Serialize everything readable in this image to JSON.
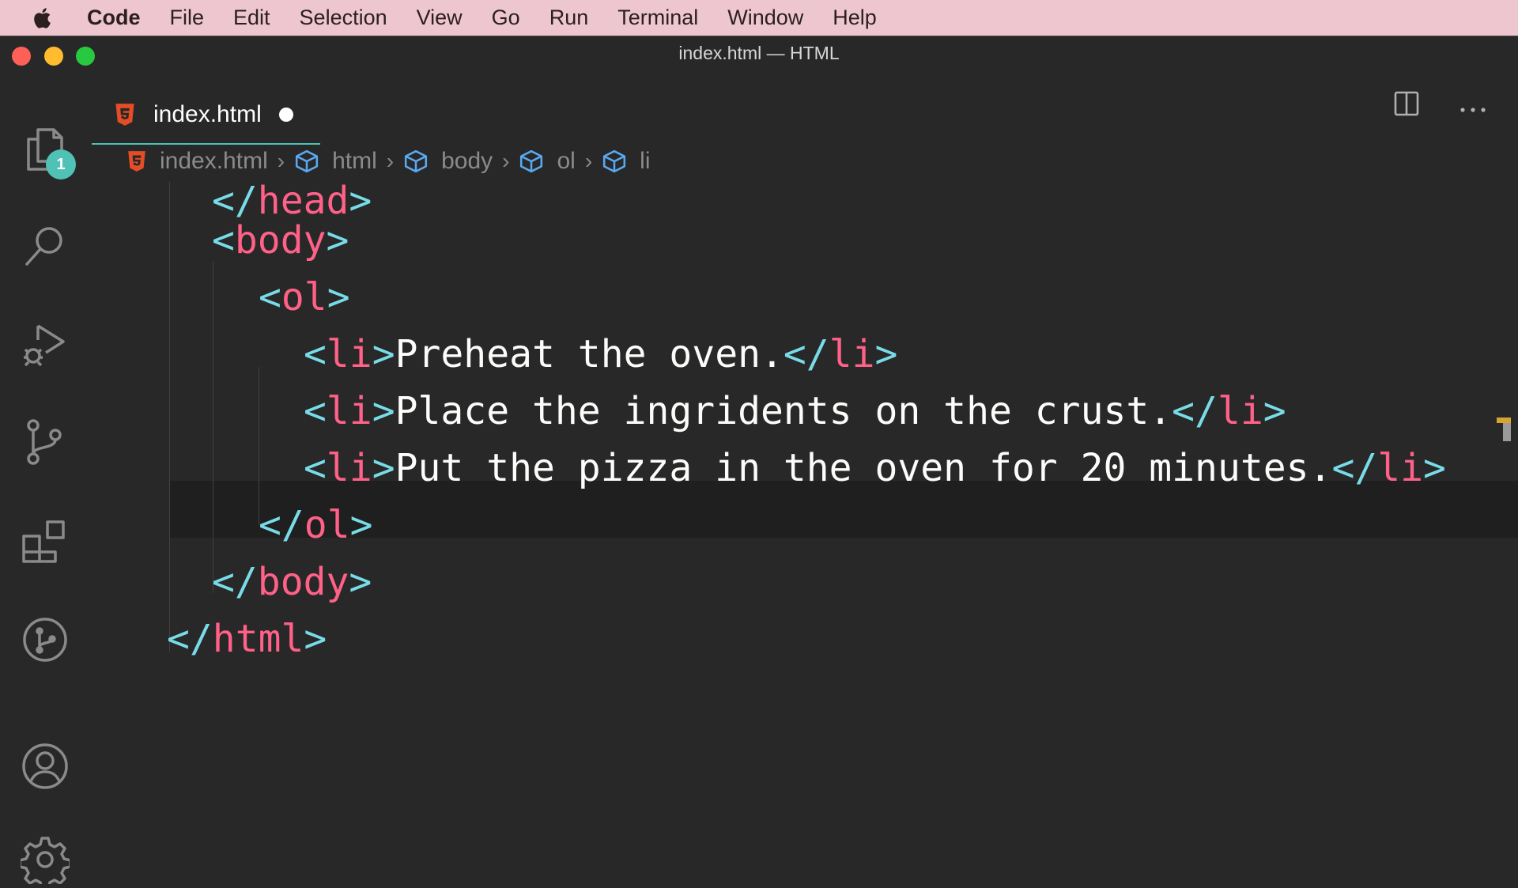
{
  "menubar": {
    "app": "Code",
    "items": [
      "File",
      "Edit",
      "Selection",
      "View",
      "Go",
      "Run",
      "Terminal",
      "Window",
      "Help"
    ]
  },
  "window": {
    "title": "index.html — HTML"
  },
  "activity_bar": {
    "icons": [
      "files-icon",
      "search-icon",
      "run-debug-icon",
      "source-control-icon",
      "extensions-icon",
      "git-graph-icon",
      "account-icon",
      "settings-gear-icon"
    ],
    "explorer_badge": "1"
  },
  "tab": {
    "label": "index.html",
    "dirty": true
  },
  "breadcrumbs": [
    "index.html",
    "html",
    "body",
    "ol",
    "li"
  ],
  "code_lines": [
    {
      "open": "</",
      "tag": "head",
      "close": ">"
    },
    {
      "open": "<",
      "tag": "body",
      "close": ">"
    },
    {
      "open": "<",
      "tag": "ol",
      "close": ">"
    },
    {
      "text": "Preheat the oven."
    },
    {
      "text": "Place the ingridents on the crust."
    },
    {
      "text": "Put the pizza in the oven for 20 minutes."
    },
    {
      "open": "</",
      "tag": "ol",
      "close": ">"
    },
    {
      "open": "</",
      "tag": "body",
      "close": ">"
    },
    {
      "open": "</",
      "tag": "html",
      "close": ">"
    }
  ],
  "li_tag": "li",
  "colors": {
    "menubar_bg": "#eec6cf",
    "editor_bg": "#282828",
    "punctuation": "#78dce8",
    "tag_name": "#ff6188",
    "text": "#fcfcfa",
    "accent": "#4fc1b5",
    "cursor": "#fc9867"
  }
}
